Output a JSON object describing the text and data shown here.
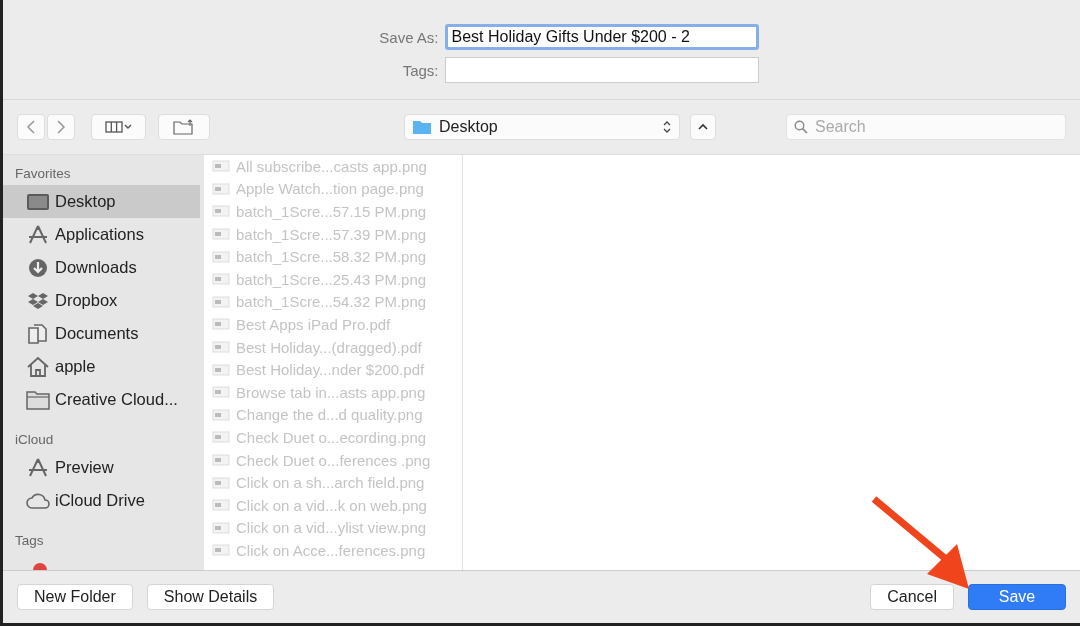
{
  "save_form": {
    "save_as_label": "Save As:",
    "save_as_value": "Best Holiday Gifts Under $200 - 2",
    "tags_label": "Tags:"
  },
  "toolbar": {
    "location": "Desktop",
    "search_placeholder": "Search"
  },
  "sidebar": {
    "sections": [
      {
        "title": "Favorites",
        "items": [
          {
            "label": "Desktop",
            "kind": "desktop",
            "selected": true
          },
          {
            "label": "Applications",
            "kind": "apps",
            "selected": false
          },
          {
            "label": "Downloads",
            "kind": "downloads",
            "selected": false
          },
          {
            "label": "Dropbox",
            "kind": "dropbox",
            "selected": false
          },
          {
            "label": "Documents",
            "kind": "documents",
            "selected": false
          },
          {
            "label": "apple",
            "kind": "home",
            "selected": false
          },
          {
            "label": "Creative Cloud...",
            "kind": "folder",
            "selected": false
          }
        ]
      },
      {
        "title": "iCloud",
        "items": [
          {
            "label": "Preview",
            "kind": "apps",
            "selected": false
          },
          {
            "label": "iCloud Drive",
            "kind": "cloud",
            "selected": false
          }
        ]
      },
      {
        "title": "Tags",
        "items": [
          {
            "kind": "tag",
            "color": "#e0443e",
            "selected": false
          }
        ]
      }
    ]
  },
  "files": [
    {
      "name": "All subscribe...casts app.png",
      "disabled": true
    },
    {
      "name": "Apple Watch...tion page.png",
      "disabled": true
    },
    {
      "name": "batch_1Scre...57.15 PM.png",
      "disabled": true
    },
    {
      "name": "batch_1Scre...57.39 PM.png",
      "disabled": true
    },
    {
      "name": "batch_1Scre...58.32 PM.png",
      "disabled": true
    },
    {
      "name": "batch_1Scre...25.43 PM.png",
      "disabled": true
    },
    {
      "name": "batch_1Scre...54.32 PM.png",
      "disabled": true
    },
    {
      "name": "Best Apps iPad Pro.pdf",
      "disabled": true
    },
    {
      "name": "Best Holiday...(dragged).pdf",
      "disabled": true
    },
    {
      "name": "Best Holiday...nder $200.pdf",
      "disabled": true
    },
    {
      "name": "Browse tab in...asts app.png",
      "disabled": true
    },
    {
      "name": "Change the d...d quality.png",
      "disabled": true
    },
    {
      "name": "Check Duet o...ecording.png",
      "disabled": true
    },
    {
      "name": "Check Duet o...ferences .png",
      "disabled": true
    },
    {
      "name": "Click on a sh...arch field.png",
      "disabled": true
    },
    {
      "name": "Click on a vid...k on web.png",
      "disabled": true
    },
    {
      "name": "Click on a vid...ylist view.png",
      "disabled": true
    },
    {
      "name": "Click on Acce...ferences.png",
      "disabled": true
    }
  ],
  "buttons": {
    "left": [
      "New Folder",
      "Show Details"
    ],
    "cancel": "Cancel",
    "save": "Save"
  }
}
